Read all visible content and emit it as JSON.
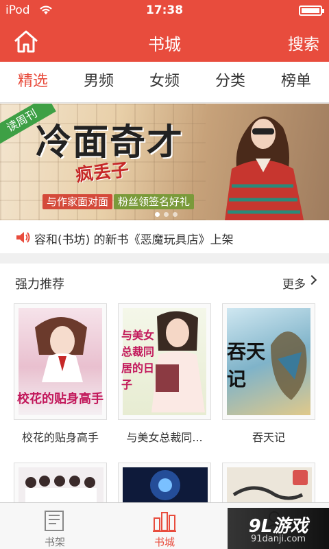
{
  "status": {
    "carrier": "iPod",
    "time": "17:38"
  },
  "header": {
    "title": "书城",
    "search_label": "搜索"
  },
  "tabs": [
    {
      "label": "精选",
      "active": true
    },
    {
      "label": "男频"
    },
    {
      "label": "女频"
    },
    {
      "label": "分类"
    },
    {
      "label": "榜单"
    }
  ],
  "banner": {
    "ribbon": "读周刊",
    "title": "冷面奇才",
    "subtitle": "疯丢子",
    "tag1": "与作家面对面",
    "tag2": "粉丝领签名好礼"
  },
  "notice": {
    "text": "容和(书坊) 的新书《恶魔玩具店》上架"
  },
  "section": {
    "title": "强力推荐",
    "more_label": "更多",
    "books": [
      {
        "name": "校花的贴身高手",
        "cover_text": "校花的贴身高手"
      },
      {
        "name": "与美女总裁同...",
        "cover_text": "与美女总裁同居的日子"
      },
      {
        "name": "吞天记",
        "cover_text": "吞天记"
      }
    ]
  },
  "bottom_nav": [
    {
      "label": "书架",
      "active": false,
      "icon": "bookshelf-icon"
    },
    {
      "label": "书城",
      "active": true,
      "icon": "bookstore-icon"
    },
    {
      "label": "",
      "active": false,
      "icon": "user-icon"
    }
  ],
  "watermark": {
    "brand": "9L游戏",
    "url": "91danji.com"
  },
  "colors": {
    "accent": "#e84c3d"
  }
}
